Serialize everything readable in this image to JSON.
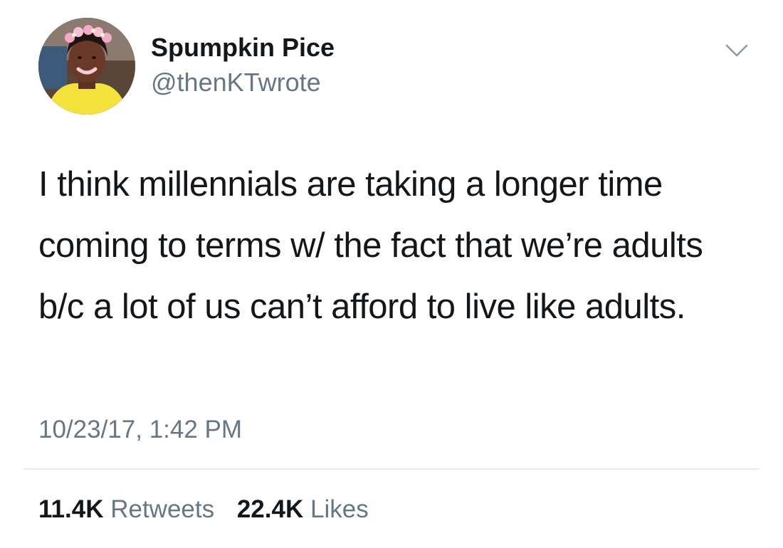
{
  "tweet": {
    "author": {
      "display_name": "Spumpkin Pice",
      "handle": "@thenKTwrote",
      "avatar_icon": "user-avatar-flower-crown"
    },
    "menu_icon": "chevron-down-icon",
    "text": "I think millennials are taking a longer time coming to terms w/ the fact that we’re adults b/c a lot of us can’t afford to live like adults.",
    "timestamp": "10/23/17, 1:42 PM",
    "stats": {
      "retweets_count": "11.4K",
      "retweets_label": "Retweets",
      "likes_count": "22.4K",
      "likes_label": "Likes"
    },
    "colors": {
      "text_primary": "#14171a",
      "text_secondary": "#657786",
      "divider": "#e6ecf0"
    }
  }
}
